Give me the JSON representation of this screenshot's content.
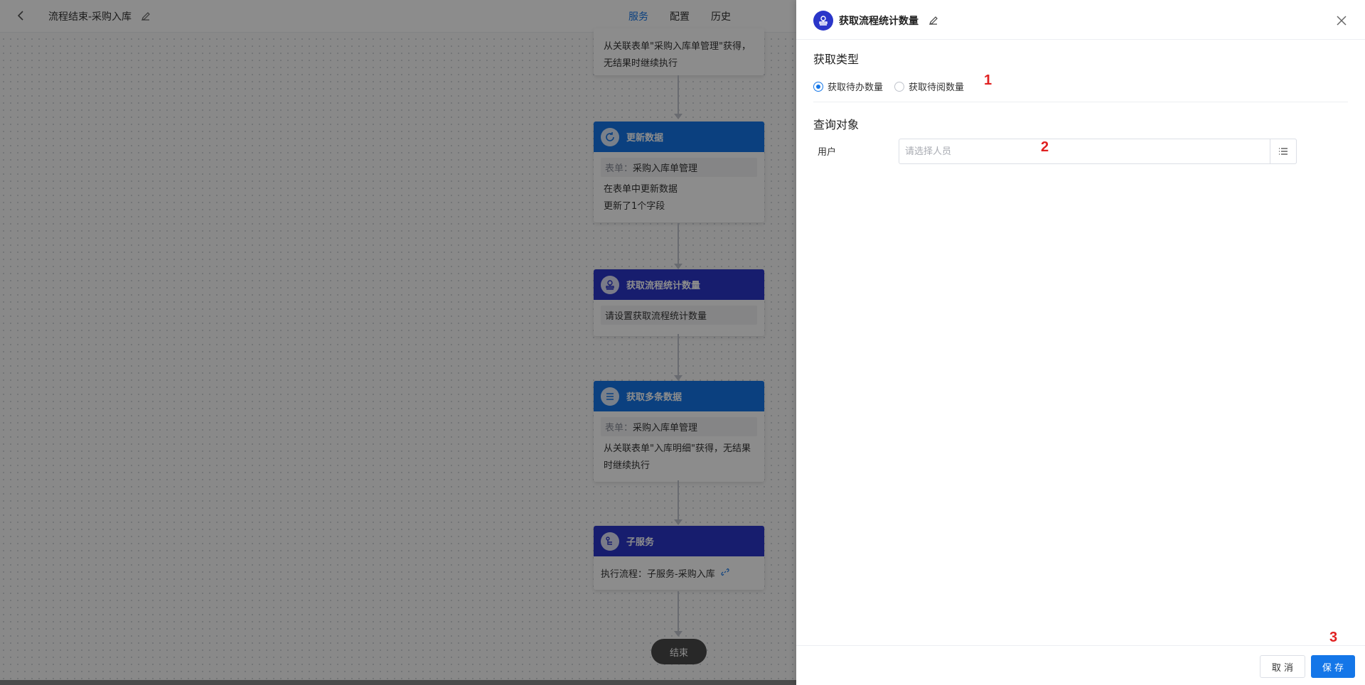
{
  "topbar": {
    "title": "流程结束-采购入库",
    "tabs": [
      "服务",
      "配置",
      "历史"
    ],
    "active_tab": 0
  },
  "nodes": {
    "partial": {
      "line1": "从关联表单\"采购入库单管理\"获得，",
      "line2": "无结果时继续执行"
    },
    "update": {
      "title": "更新数据",
      "tag_label": "表单：",
      "tag_value": "采购入库单管理",
      "line1": "在表单中更新数据",
      "line2": "更新了1个字段"
    },
    "stats": {
      "title": "获取流程统计数量",
      "line1": "请设置获取流程统计数量"
    },
    "multi": {
      "title": "获取多条数据",
      "tag_label": "表单：",
      "tag_value": "采购入库单管理",
      "line1": "从关联表单\"入库明细\"获得，无结果",
      "line2": "时继续执行"
    },
    "sub": {
      "title": "子服务",
      "line1": "执行流程：子服务-采购入库"
    }
  },
  "end_label": "结束",
  "panel": {
    "title": "获取流程统计数量",
    "section1": "获取类型",
    "radio_options": [
      "获取待办数量",
      "获取待阅数量"
    ],
    "radio_selected": 0,
    "section2": "查询对象",
    "user_label": "用户",
    "user_placeholder": "请选择人员",
    "user_value": "",
    "cancel_label": "取 消",
    "save_label": "保 存"
  },
  "annotations": [
    "1",
    "2",
    "3"
  ],
  "colors": {
    "accent": "#1476e8",
    "node_blue": "#1476e8",
    "node_indigo": "#2a36c9",
    "annotation": "#e02020"
  }
}
